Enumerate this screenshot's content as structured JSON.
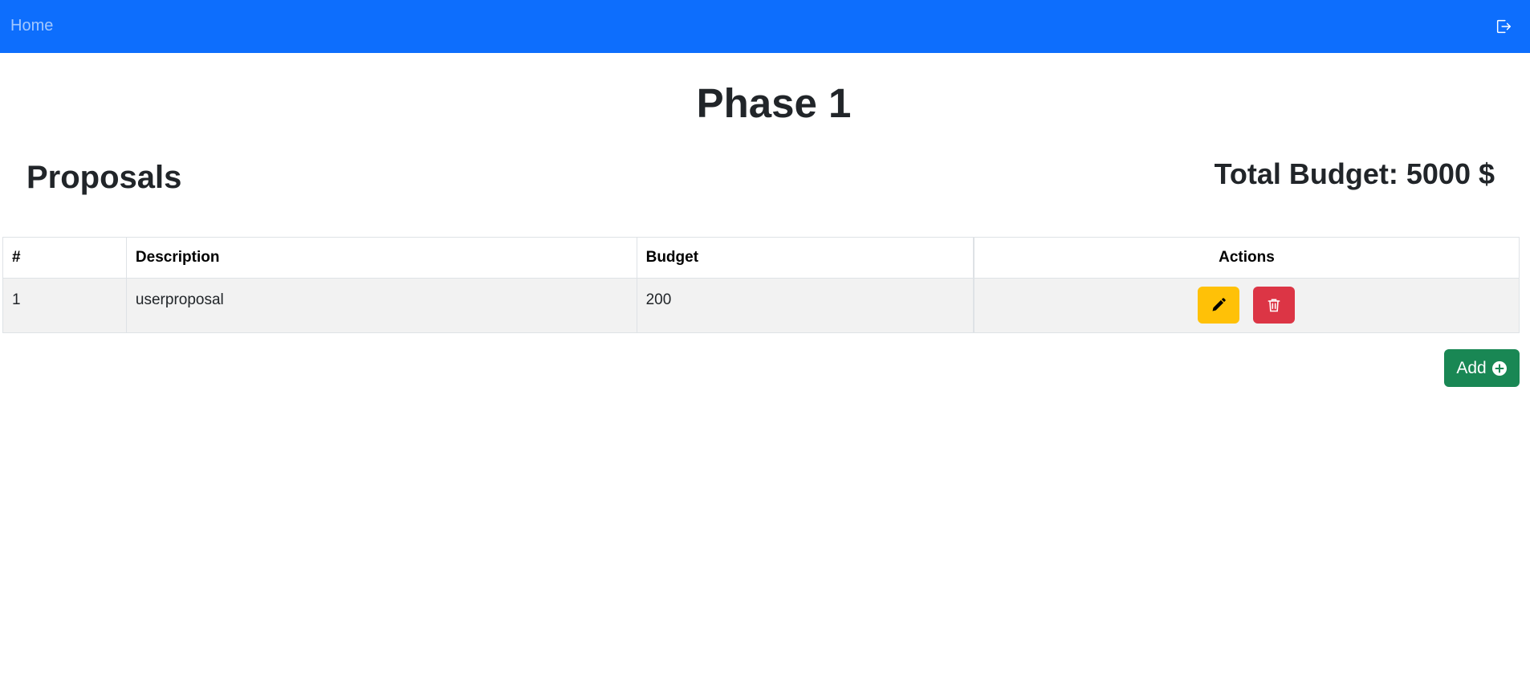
{
  "navbar": {
    "home_label": "Home",
    "logout_icon": "logout-icon",
    "color": "#0d6efd"
  },
  "page": {
    "title": "Phase 1",
    "section_title": "Proposals",
    "total_budget": "Total Budget: 5000 $"
  },
  "table": {
    "headers": [
      "#",
      "Description",
      "Budget",
      "Actions"
    ],
    "rows": [
      {
        "num": "1",
        "description": "userproposal",
        "budget": "200"
      }
    ]
  },
  "actions": {
    "edit_icon": "pencil-icon",
    "delete_icon": "trash-icon",
    "edit_color": "#ffc107",
    "delete_color": "#dc3545"
  },
  "add_button": {
    "label": "Add",
    "icon": "plus-circle-icon",
    "color": "#198754"
  }
}
